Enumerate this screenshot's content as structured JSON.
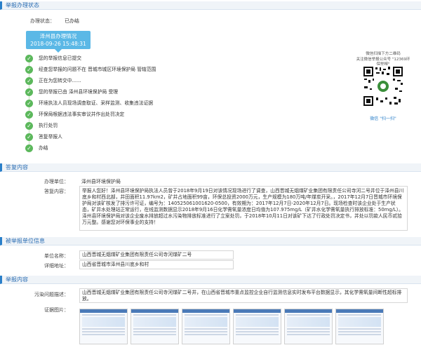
{
  "sections": {
    "status_title": "举报办理状态",
    "reply_title": "答复内容",
    "reported_unit_title": "被举报单位信息",
    "report_title": "举报内容"
  },
  "status": {
    "label": "办理状态：",
    "value": "已办结",
    "tip_title": "泽州县办理情况",
    "tip_time": "2018-09-26 15:48:31",
    "steps": [
      "您的举报信息已提交",
      "经查您举报的问题不在 晋城市城区环境保护局 管辖范围",
      "正在为您转交中......",
      "您的举报已由 泽州县环境保护局 受理",
      "环境执法人员现场调查取证、采样监测、收集违法证据",
      "环保局根据违法事实审议并作出处罚决定",
      "执行处罚",
      "答复举报人",
      "办结"
    ]
  },
  "qr": {
    "cap1": "微信扫描下方二维码",
    "cap2": "关注微信举报公众号 \"12369环保举报\"",
    "scan": "微信 \"扫一扫\""
  },
  "reply": {
    "unit_label": "办理单位：",
    "unit_value": "泽州县环境保护局",
    "content_label": "答复内容：",
    "content_value": "举报人您好！泽州县环境保护局执法人员曾于2018年9月19日对该情况现场进行了调查，山西晋城无烟煤矿业集团有限责任公司寺河二号井位于泽州县川底乡和村西北部，井田面积11.97km2，矿井占地面积99亩，环保总投资2000万元，生产规模为180万吨/年煤炭开采。，2017年12月7日晋城市环境保护局对该矿核发了排污许可证，编号为：140525061001620-0500，有效期为：2017年12月7日-2020年12月7日。现场检查时该企业处于生产状态，矿井水处理站正常运行，在线监测数据显示2018年9月16日化学需氧量浓度日均值为107.975mg/L（矿井水化学需氧量执行排放标准：50mg/L）。泽州县环境保护局对该企业废水排放超过水污染物排放标准进行了立案处罚，于2018年10月11日对该矿下达了行政处罚决定书，并处以罚款人民币贰拾万元整。感谢您对环保事业的支持！"
  },
  "reported_unit": {
    "name_label": "单位名称：",
    "name_value": "山西晋城无烟煤矿业集团有限责任公司寺河煤矿二号",
    "addr_label": "详细地址：",
    "addr_value": "山西省晋城市泽州县川底乡和村"
  },
  "report": {
    "desc_label": "污染问题描述：",
    "desc_value": "山西晋城无烟煤矿业集团有限责任公司寺河煤矿二号井，在山西省晋城市重点监控企业自行监测信息实时发布平台数据显示，其化学需氧量间断性超标排放。",
    "evidence_label": "证据图片："
  },
  "colors": {
    "accent": "#2a7fc9",
    "step_green": "#5cb85c",
    "tip_blue": "#5bb8e6"
  },
  "icons": {
    "step": "check-circle-icon",
    "qr": "qr-code-icon"
  }
}
